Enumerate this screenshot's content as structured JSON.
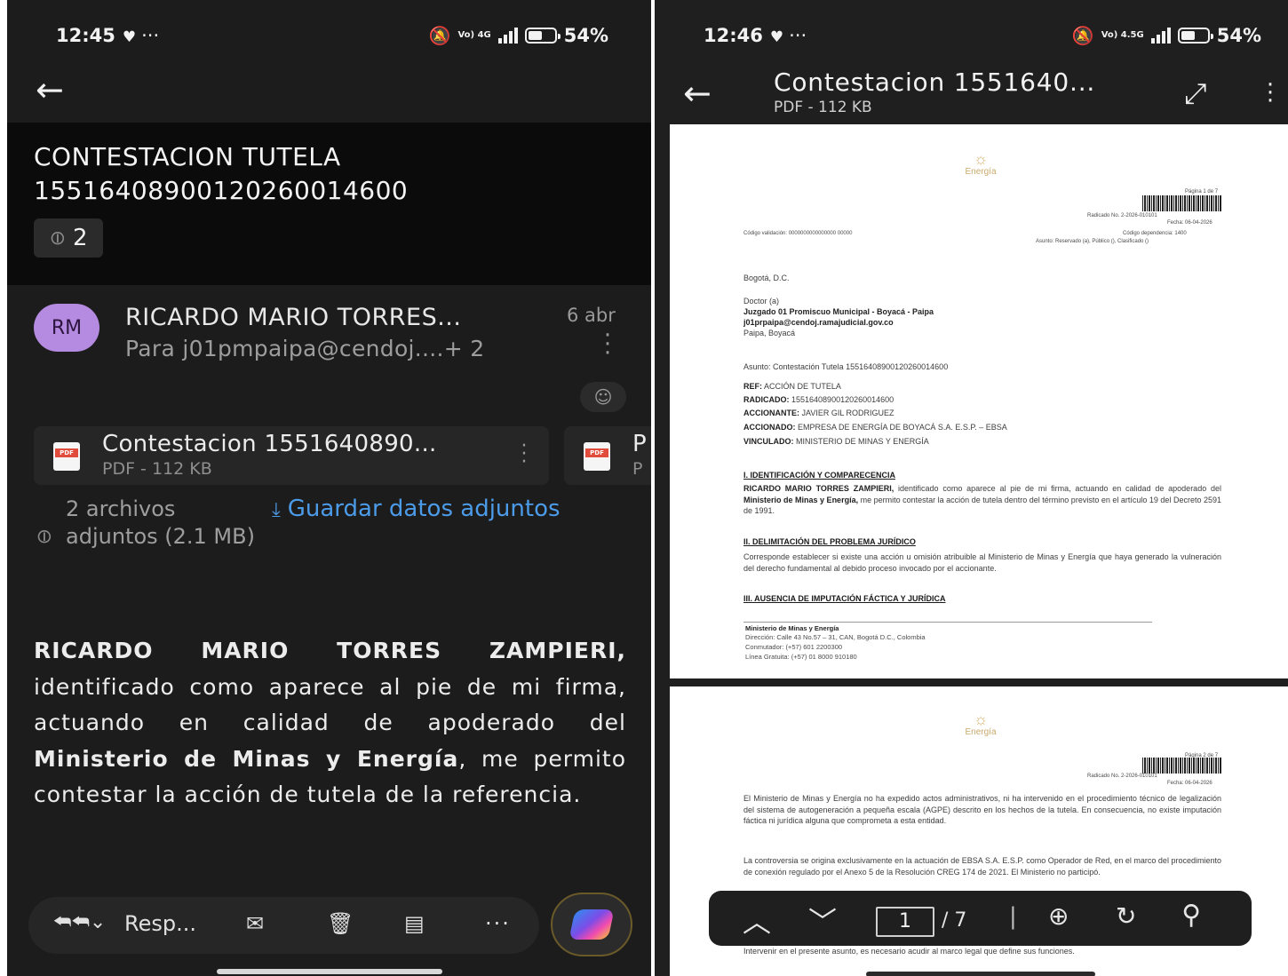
{
  "left": {
    "status": {
      "time": "12:45",
      "extra": "···",
      "net": "Vo) 4G",
      "battery": "54%",
      "battery_level": 0.54
    },
    "subject": "CONTESTACION TUTELA 15516408900120260014600",
    "attachment_count": "2",
    "sender": {
      "initials": "RM",
      "name": "RICARDO MARIO TORRES...",
      "to": "Para j01pmpaipa@cendoj....+ 2",
      "date": "6 abr"
    },
    "attachments": [
      {
        "name": "Contestacion 1551640890...",
        "meta": "PDF - 112 KB",
        "badge": "PDF"
      },
      {
        "name": "P",
        "meta": "P",
        "badge": "PDF"
      }
    ],
    "attachments_summary": "2 archivos adjuntos (2.1 MB)",
    "save_label": "Guardar datos adjuntos",
    "body": {
      "p1": "RICARDO MARIO TORRES ZAMPIERI,",
      "p2": " identificado como aparece al pie de mi firma, actuando en calidad de apoderado del ",
      "p3": "Ministerio de Minas y Energía",
      "p4": ", me permito contestar la acción de tutela de la referencia."
    },
    "bottom_bar": {
      "reply_label": "Resp..."
    }
  },
  "right": {
    "status": {
      "time": "12:46",
      "extra": "···",
      "net": "Vo) 4.5G",
      "battery": "54%",
      "battery_level": 0.54
    },
    "doc_title": "Contestacion 1551640...",
    "doc_meta": "PDF - 112 KB",
    "page1": {
      "logo_text": "Energía",
      "page_label": "Página 1 de 7",
      "radicado": "Radicado No. 2-2026-010101",
      "fecha": "Fecha: 06-04-2026",
      "codigo_left": "Código validación: 0000000000000000 00000",
      "codigo_right": "Código dependencia: 1400",
      "clasificacion": "Asunto: Reservado (a), Público (), Clasificado ()",
      "city": "Bogotá, D.C.",
      "doctor": "Doctor (a)",
      "juzgado": "Juzgado 01 Promiscuo Municipal - Boyacá - Paipa",
      "email": "j01prpaipa@cendoj.ramajudicial.gov.co",
      "place": "Paipa, Boyacá",
      "asunto": "Asunto: Contestación Tutela 15516408900120260014600",
      "ref_label": "REF:",
      "ref": "ACCIÓN DE TUTELA",
      "radicado_label": "RADICADO:",
      "radicado_val": "15516408900120260014600",
      "accionante_label": "ACCIONANTE:",
      "accionante": "JAVIER GIL RODRIGUEZ",
      "accionado_label": "ACCIONADO:",
      "accionado": "EMPRESA DE ENERGÍA DE BOYACÁ S.A. E.S.P. – EBSA",
      "vinculado_label": "VINCULADO:",
      "vinculado": "MINISTERIO DE MINAS Y ENERGÍA",
      "s1": "I. IDENTIFICACIÓN Y COMPARECENCIA",
      "p1a": "RICARDO MARIO TORRES ZAMPIERI,",
      "p1b": " identificado como aparece al pie de mi firma, actuando en calidad de apoderado del ",
      "p1c": "Ministerio de Minas y Energía,",
      "p1d": " me permito contestar la acción de tutela dentro del término previsto en el artículo 19 del Decreto 2591 de 1991.",
      "s2": "II. DELIMITACIÓN DEL PROBLEMA JURÍDICO",
      "p2": "Corresponde establecer si existe una acción u omisión atribuible al Ministerio de Minas y Energía que haya generado la vulneración del derecho fundamental al debido proceso invocado por el accionante.",
      "s3": "III. AUSENCIA DE IMPUTACIÓN FÁCTICA Y JURÍDICA",
      "f1": "Ministerio de Minas y Energía",
      "f2": "Dirección: Calle 43 No.57 – 31, CAN, Bogotá D.C., Colombia",
      "f3": "Conmutador: (+57) 601 2200300",
      "f4": "Línea Gratuita: (+57) 01 8000 910180"
    },
    "page2": {
      "logo_text": "Energía",
      "page_label": "Página 2 de 7",
      "radicado": "Radicado No. 2-2026-010101",
      "fecha": "Fecha: 06-04-2026",
      "p1": "El Ministerio de Minas y Energía no ha expedido actos administrativos, ni ha intervenido en el procedimiento técnico de legalización del sistema de autogeneración a pequeña escala (AGPE) descrito en los hechos de la tutela. En consecuencia, no existe imputación fáctica ni jurídica alguna que comprometa a esta entidad.",
      "p2": "La controversia se origina exclusivamente en la actuación de EBSA S.A. E.S.P. como Operador de Red, en el marco del procedimiento de conexión regulado por el Anexo 5 de la Resolución CREG 174 de 2021. El Ministerio no participó.",
      "p3": "Intervenir en el presente asunto, es necesario acudir al marco legal que define sus funciones."
    },
    "toolbar": {
      "current_page": "1",
      "total": "/ 7"
    }
  }
}
